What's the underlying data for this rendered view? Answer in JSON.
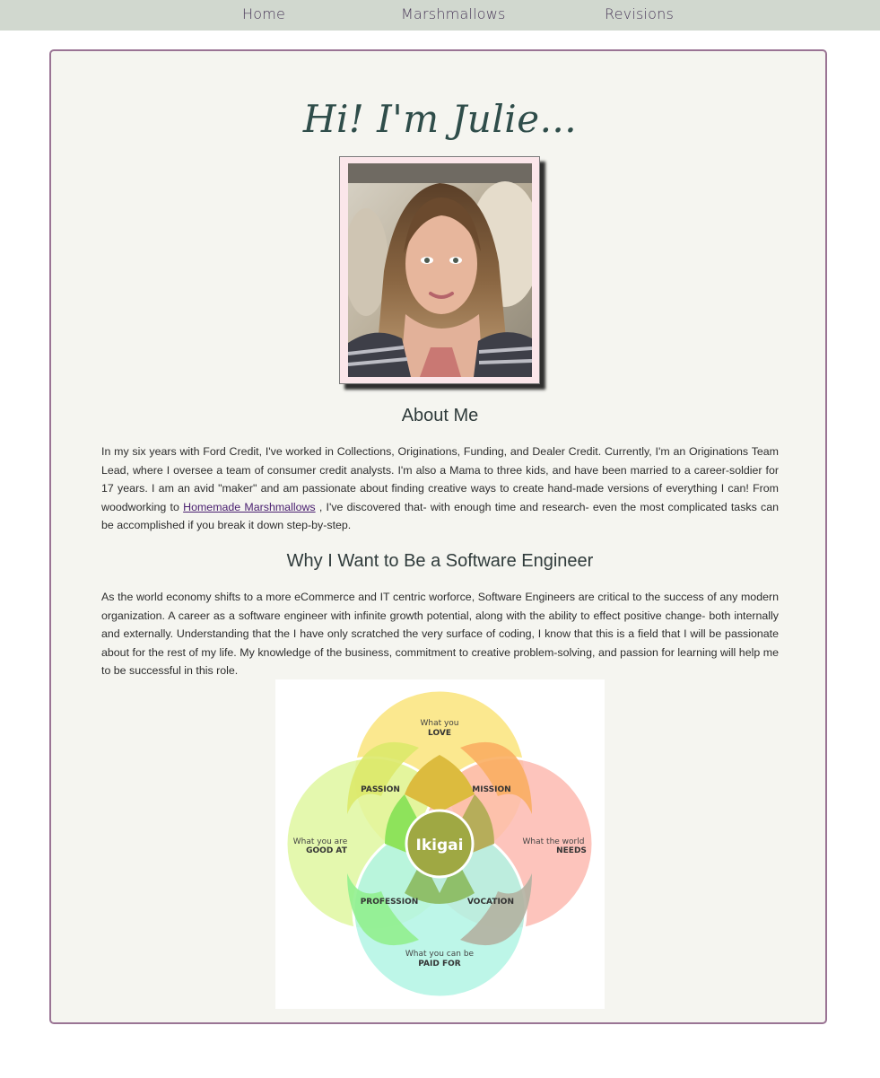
{
  "nav": {
    "home": "Home",
    "marshmallows": "Marshmallows",
    "revisions": "Revisions"
  },
  "greeting": "Hi! I'm Julie...",
  "photo": {
    "alt": "Portrait photo of Julie"
  },
  "about": {
    "heading": "About Me",
    "text_before_link": "In my six years with Ford Credit, I've worked in Collections, Originations, Funding, and Dealer Credit. Currently, I'm an Originations Team Lead, where I oversee a team of consumer credit analysts. I'm also a Mama to three kids, and have been married to a career-soldier for 17 years. I am an avid \"maker\" and am passionate about finding creative ways to create hand-made versions of everything I can! From woodworking to ",
    "link_text": "Homemade Marshmallows",
    "text_after_link": " , I've discovered that- with enough time and research- even the most complicated tasks can be accomplished if you break it down step-by-step."
  },
  "why": {
    "heading": "Why I Want to Be a Software Engineer",
    "text": "As the world economy shifts to a more eCommerce and IT centric worforce, Software Engineers are critical to the success of any modern organization. A career as a software engineer with infinite growth potential, along with the ability to effect positive change- both internally and externally. Understanding that the I have only scratched the very surface of coding, I know that this is a field that I will be passionate about for the rest of my life. My knowledge of the business, commitment to creative problem-solving, and passion for learning will help me to be successful in this role."
  },
  "ikigai": {
    "center": "Ikigai",
    "love_1": "What you",
    "love_2": "LOVE",
    "good_1": "What you are",
    "good_2": "GOOD AT",
    "needs_1": "What the world",
    "needs_2": "NEEDS",
    "paid_1": "What you can be",
    "paid_2": "PAID FOR",
    "passion": "PASSION",
    "mission": "MISSION",
    "profession": "PROFESSION",
    "vocation": "VOCATION",
    "colors": {
      "love": "#fbe88f",
      "good": "#dff7a0",
      "needs": "#fdbab0",
      "paid": "#b2f5e4"
    }
  }
}
